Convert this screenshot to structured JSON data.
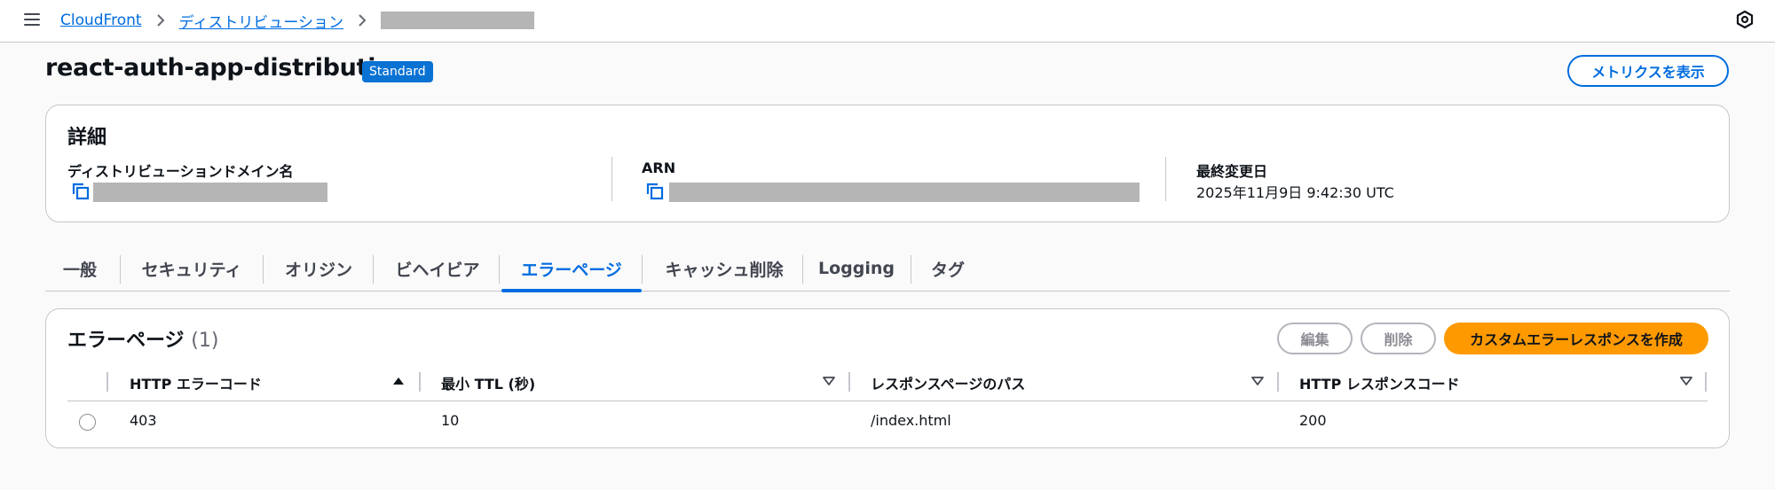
{
  "breadcrumb": {
    "items": [
      "CloudFront",
      "ディストリビューション"
    ]
  },
  "header": {
    "title": "react-auth-app-distribution",
    "badge": "Standard",
    "metrics_button": "メトリクスを表示"
  },
  "details": {
    "title": "詳細",
    "domain_label": "ディストリビューションドメイン名",
    "arn_label": "ARN",
    "modified_label": "最終変更日",
    "modified_value": "2025年11月9日 9:42:30 UTC"
  },
  "tabs": [
    "一般",
    "セキュリティ",
    "オリジン",
    "ビヘイビア",
    "エラーページ",
    "キャッシュ削除",
    "Logging",
    "タグ"
  ],
  "active_tab": "エラーページ",
  "error_pages": {
    "title": "エラーページ",
    "count": "(1)",
    "edit_button": "編集",
    "delete_button": "削除",
    "create_button": "カスタムエラーレスポンスを作成",
    "columns": [
      "HTTP エラーコード",
      "最小 TTL (秒)",
      "レスポンスページのパス",
      "HTTP レスポンスコード"
    ],
    "rows": [
      {
        "error_code": "403",
        "min_ttl": "10",
        "response_path": "/index.html",
        "response_code": "200"
      }
    ]
  },
  "colors": {
    "accent": "#006ce0",
    "primary_button": "#ff9900",
    "badge": "#0972d3"
  },
  "icons": {
    "menu": "hamburger-menu-icon",
    "breadcrumb_separator": "chevron-right-icon",
    "settings": "hexagon-settings-icon",
    "copy": "copy-icon",
    "sort_asc": "caret-up-icon",
    "sort_desc": "caret-down-icon"
  }
}
